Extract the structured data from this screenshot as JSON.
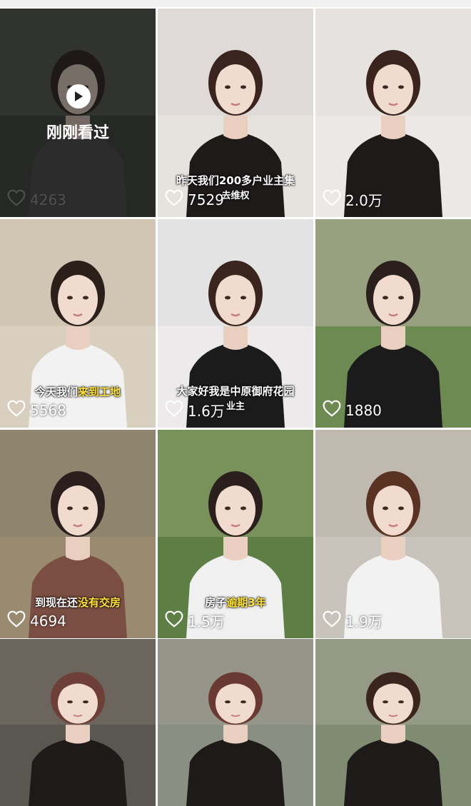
{
  "tiles": [
    {
      "likes": "4263",
      "caption_plain": "",
      "caption_hl": "",
      "watched": true,
      "bg": "#3b4239",
      "shirt": "#4a4a4a",
      "hair": "#2a1f1c",
      "wall": "#6b6f66"
    },
    {
      "likes": "7529",
      "caption_plain": "昨天我们200多户业主集",
      "caption_hl": "",
      "caption2": "去维权",
      "watched": false,
      "bg": "#e6e3df",
      "shirt": "#1e1a1a",
      "hair": "#3a241d",
      "wall": "#d8d4cf"
    },
    {
      "likes": "2.0万",
      "caption_plain": "",
      "caption_hl": "",
      "watched": false,
      "bg": "#ece8e6",
      "shirt": "#1e1a1a",
      "hair": "#3a241d",
      "wall": "#e0dcd8"
    },
    {
      "likes": "5568",
      "caption_plain": "今天我们",
      "caption_hl": "来到工地",
      "watched": false,
      "bg": "#d8cfbe",
      "shirt": "#f2f2f2",
      "hair": "#2b1f1a",
      "wall": "#cbbfa9"
    },
    {
      "likes": "1.6万",
      "caption_plain": "大家好我是中原御府花园",
      "caption_hl": "",
      "caption2": "业主",
      "watched": false,
      "bg": "#eceaea",
      "shirt": "#1b1b1b",
      "hair": "#3a241d",
      "wall": "#dcdcdc"
    },
    {
      "likes": "1880",
      "caption_plain": "",
      "caption_hl": "",
      "watched": false,
      "bg": "#6d8a52",
      "shirt": "#1b1b1b",
      "hair": "#2a1f1c",
      "wall": "#b9b4a6"
    },
    {
      "likes": "4694",
      "caption_plain": "到现在还",
      "caption_hl": "没有交房",
      "watched": false,
      "bg": "#9a8a70",
      "shirt": "#7a4e42",
      "hair": "#2a1f1c",
      "wall": "#87806d"
    },
    {
      "likes": "1.5万",
      "caption_plain": "房子",
      "caption_hl": "逾期3年",
      "watched": false,
      "bg": "#5d7e45",
      "shirt": "#f0f0f0",
      "hair": "#2a1f1c",
      "wall": "#8fa06b"
    },
    {
      "likes": "1.9万",
      "caption_plain": "",
      "caption_hl": "",
      "watched": false,
      "bg": "#c9c4bb",
      "shirt": "#f2f2f2",
      "hair": "#5a3223",
      "wall": "#b8b1a6"
    },
    {
      "likes": "",
      "caption_plain": "",
      "caption_hl": "",
      "watched": false,
      "bg": "#5a5650",
      "shirt": "#1e1a1a",
      "hair": "#6e3f37",
      "wall": "#7a7268"
    },
    {
      "likes": "",
      "caption_plain": "",
      "caption_hl": "",
      "watched": false,
      "bg": "#8a8f84",
      "shirt": "#1e1a1a",
      "hair": "#6a3a32",
      "wall": "#a09b8f"
    },
    {
      "likes": "",
      "caption_plain": "",
      "caption_hl": "",
      "watched": false,
      "bg": "#7f8c72",
      "shirt": "#1e1a1a",
      "hair": "#3a241d",
      "wall": "#a8a697"
    }
  ],
  "watched_label": "刚刚看过",
  "icons": {
    "like": "heart-icon",
    "play": "play-icon"
  }
}
